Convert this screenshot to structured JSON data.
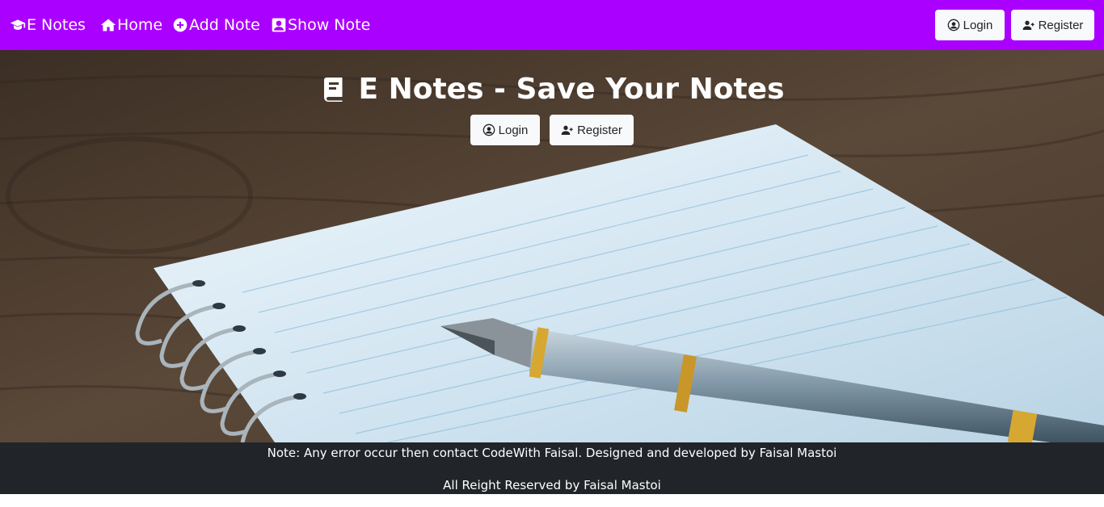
{
  "navbar": {
    "brand": "E Notes",
    "links": [
      {
        "label": "Home",
        "icon": "home-icon"
      },
      {
        "label": "Add Note",
        "icon": "plus-circle-icon"
      },
      {
        "label": "Show Note",
        "icon": "user-portrait-icon"
      }
    ],
    "login_label": "Login",
    "register_label": "Register",
    "background_color": "#aa00ff"
  },
  "hero": {
    "title": "E Notes - Save Your Notes",
    "login_label": "Login",
    "register_label": "Register"
  },
  "footer": {
    "note": "Note: Any error occur then contact CodeWith Faisal. Designed and developed by Faisal Mastoi",
    "rights": "All Reight Reserved by Faisal Mastoi",
    "background_color": "#212529"
  }
}
